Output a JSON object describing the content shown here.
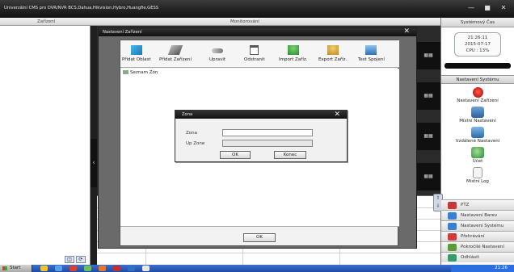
{
  "window": {
    "title": "Univerzální CMS pro DVR/NVR BCS,Dahua,Hikvision,Hybro,Huangfie,GESS",
    "minimize": "—",
    "maximize": "■",
    "close": "✕"
  },
  "header": {
    "devices_label": "Zařízení",
    "monitoring_label": "Monitorování"
  },
  "right_sidebar": {
    "system_time_label": "Systémový Čas",
    "clock_time": "21:26:11",
    "clock_date": "2015-07-17",
    "cpu": "CPU : 13%",
    "system_settings_header": "Nastavení Systému",
    "items": [
      {
        "label": "Nastavení Zařízení",
        "icon": "red-circle-icon"
      },
      {
        "label": "Místní Nastavení",
        "icon": "network-icon"
      },
      {
        "label": "Vzdálené Nastavení",
        "icon": "remote-icon"
      },
      {
        "label": "Účet",
        "icon": "user-icon"
      },
      {
        "label": "Místní Log",
        "icon": "document-icon"
      }
    ],
    "bottom_buttons": [
      {
        "label": "PTZ",
        "color": "#c23b3b"
      },
      {
        "label": "Nastavení Barev",
        "color": "#3a7fd0"
      },
      {
        "label": "Nastavení Systému",
        "color": "#3a7fd0"
      },
      {
        "label": "Přehrávání",
        "color": "#d03a3a"
      },
      {
        "label": "Pokročilé Nastavení",
        "color": "#5a9a3a"
      },
      {
        "label": "Odhlásit",
        "color": "#3a9a6a"
      }
    ]
  },
  "video_tiles": [
    "▦▦",
    "▦▦",
    "▦▦",
    "▦▦"
  ],
  "device_dialog": {
    "title": "Nastavení Zařízení",
    "close": "✕",
    "toolbar": [
      {
        "label": "Přidat Oblast",
        "icon": "add-area-icon"
      },
      {
        "label": "Přidat Zařízení",
        "icon": "add-device-icon"
      },
      {
        "label": "Upravit",
        "icon": "edit-icon"
      },
      {
        "label": "Odstranit",
        "icon": "delete-icon"
      },
      {
        "label": "Import Zaříz.",
        "icon": "import-icon"
      },
      {
        "label": "Export Zaříz.",
        "icon": "export-icon"
      },
      {
        "label": "Test Spojení",
        "icon": "test-connection-icon"
      }
    ],
    "tree_root": "Seznam Zón",
    "ok_label": "OK"
  },
  "zona_dialog": {
    "title": "Zona",
    "close": "✕",
    "zona_label": "Zona",
    "zona_value": "",
    "upzone_label": "Up Zone",
    "upzone_value": "",
    "ok_label": "OK",
    "cancel_label": "Konec"
  },
  "left_tools": [
    "◫",
    "⟳"
  ],
  "taskbar": {
    "start_label": "Start",
    "tray_time": "21:26"
  }
}
